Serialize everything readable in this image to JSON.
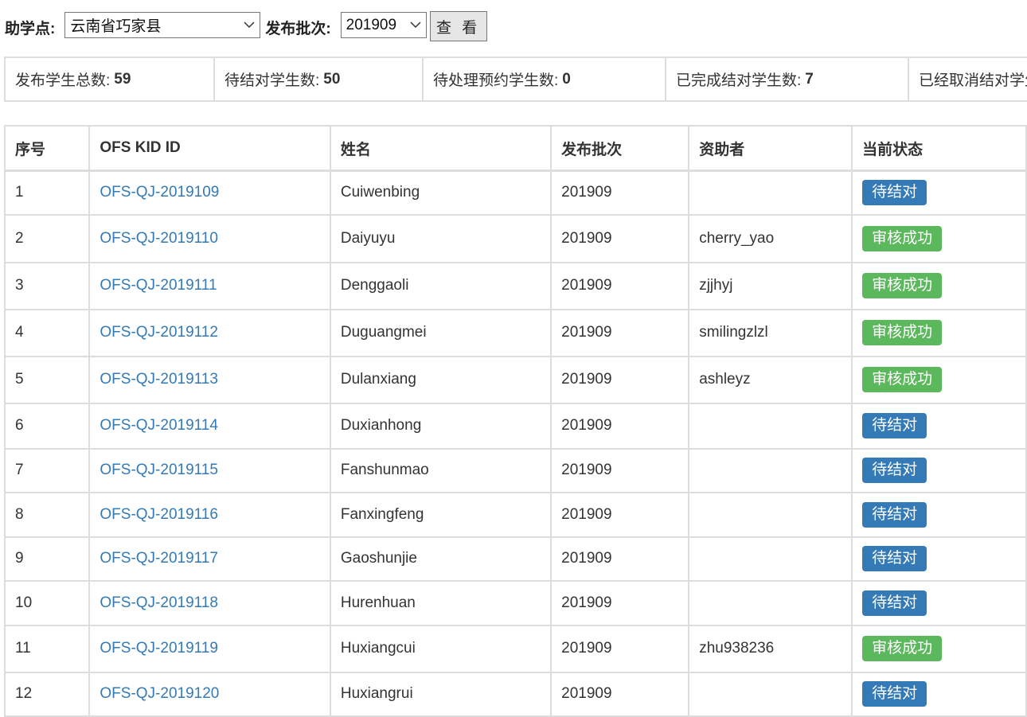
{
  "filter": {
    "site_label": "助学点:",
    "site_value": "云南省巧家县",
    "batch_label": "发布批次:",
    "batch_value": "201909",
    "view_button": "查 看"
  },
  "stats": [
    {
      "label": "发布学生总数:",
      "value": "59"
    },
    {
      "label": "待结对学生数:",
      "value": "50"
    },
    {
      "label": "待处理预约学生数:",
      "value": "0"
    },
    {
      "label": "已完成结对学生数:",
      "value": "7"
    },
    {
      "label": "已经取消结对学生数:",
      "value": ""
    }
  ],
  "table": {
    "headers": [
      "序号",
      "OFS KID ID",
      "姓名",
      "发布批次",
      "资助者",
      "当前状态"
    ],
    "rows": [
      {
        "no": "1",
        "kid": "OFS-QJ-2019109",
        "name": "Cuiwenbing",
        "batch": "201909",
        "sponsor": "",
        "status": "待结对",
        "status_type": "pending"
      },
      {
        "no": "2",
        "kid": "OFS-QJ-2019110",
        "name": "Daiyuyu",
        "batch": "201909",
        "sponsor": "cherry_yao",
        "status": "审核成功",
        "status_type": "approved"
      },
      {
        "no": "3",
        "kid": "OFS-QJ-2019111",
        "name": "Denggaoli",
        "batch": "201909",
        "sponsor": "zjjhyj",
        "status": "审核成功",
        "status_type": "approved"
      },
      {
        "no": "4",
        "kid": "OFS-QJ-2019112",
        "name": "Duguangmei",
        "batch": "201909",
        "sponsor": "smilingzlzl",
        "status": "审核成功",
        "status_type": "approved"
      },
      {
        "no": "5",
        "kid": "OFS-QJ-2019113",
        "name": "Dulanxiang",
        "batch": "201909",
        "sponsor": "ashleyz",
        "status": "审核成功",
        "status_type": "approved"
      },
      {
        "no": "6",
        "kid": "OFS-QJ-2019114",
        "name": "Duxianhong",
        "batch": "201909",
        "sponsor": "",
        "status": "待结对",
        "status_type": "pending"
      },
      {
        "no": "7",
        "kid": "OFS-QJ-2019115",
        "name": "Fanshunmao",
        "batch": "201909",
        "sponsor": "",
        "status": "待结对",
        "status_type": "pending"
      },
      {
        "no": "8",
        "kid": "OFS-QJ-2019116",
        "name": "Fanxingfeng",
        "batch": "201909",
        "sponsor": "",
        "status": "待结对",
        "status_type": "pending"
      },
      {
        "no": "9",
        "kid": "OFS-QJ-2019117",
        "name": "Gaoshunjie",
        "batch": "201909",
        "sponsor": "",
        "status": "待结对",
        "status_type": "pending"
      },
      {
        "no": "10",
        "kid": "OFS-QJ-2019118",
        "name": "Hurenhuan",
        "batch": "201909",
        "sponsor": "",
        "status": "待结对",
        "status_type": "pending"
      },
      {
        "no": "11",
        "kid": "OFS-QJ-2019119",
        "name": "Huxiangcui",
        "batch": "201909",
        "sponsor": "zhu938236",
        "status": "审核成功",
        "status_type": "approved"
      },
      {
        "no": "12",
        "kid": "OFS-QJ-2019120",
        "name": "Huxiangrui",
        "batch": "201909",
        "sponsor": "",
        "status": "待结对",
        "status_type": "pending"
      }
    ]
  },
  "colors": {
    "link": "#337ab7",
    "pending_badge": "#337ab7",
    "approved_badge": "#5cb85c",
    "border": "#dddddd"
  },
  "icons": {
    "select_arrow": "chevron-down-icon"
  }
}
